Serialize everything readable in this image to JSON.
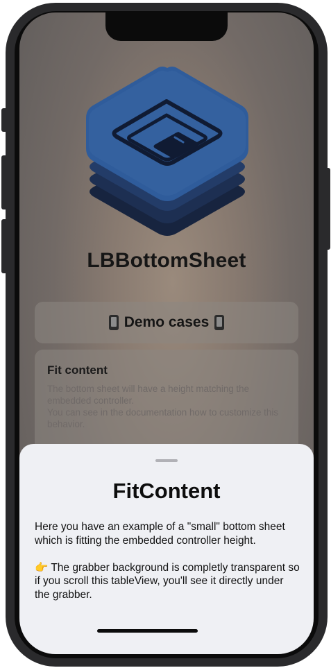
{
  "app": {
    "title": "LBBottomSheet"
  },
  "list": {
    "demo_header": "Demo cases",
    "cards": [
      {
        "title": "Fit content",
        "description": "The bottom sheet will have a height matching the embedded controller.\nYou can see in the documentation how to customize this behavior."
      }
    ]
  },
  "bottom_sheet": {
    "title": "FitContent",
    "paragraph1": "Here you have an example of a \"small\" bottom sheet which is fitting the embedded controller height.",
    "paragraph2": "👉 The grabber background is completly transparent so if you scroll this tableView, you'll see it directly under the grabber."
  },
  "icons": [
    "app-logo-icon",
    "phone-icon",
    "grabber-handle",
    "home-indicator"
  ],
  "colors": {
    "sheet_background": "#eff0f4",
    "logo_primary": "#2e5a99",
    "logo_dark": "#14203a"
  }
}
